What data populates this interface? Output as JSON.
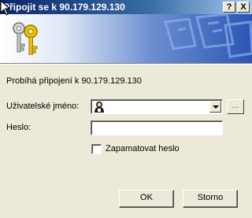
{
  "window": {
    "title": "Připojit se k 90.179.129.130",
    "help_glyph": "?",
    "close_glyph": "X"
  },
  "banner": {
    "icon": "keys-icon"
  },
  "form": {
    "info_text": "Probíhá připojení k 90.179.129.130",
    "username_label": "Uživatelské jméno:",
    "username_value": "",
    "username_icon": "user-icon",
    "browse_label": "...",
    "password_label": "Heslo:",
    "password_value": "",
    "remember_label": "Zapamatovat heslo",
    "remember_checked": false
  },
  "buttons": {
    "ok_label": "OK",
    "cancel_label": "Storno"
  }
}
